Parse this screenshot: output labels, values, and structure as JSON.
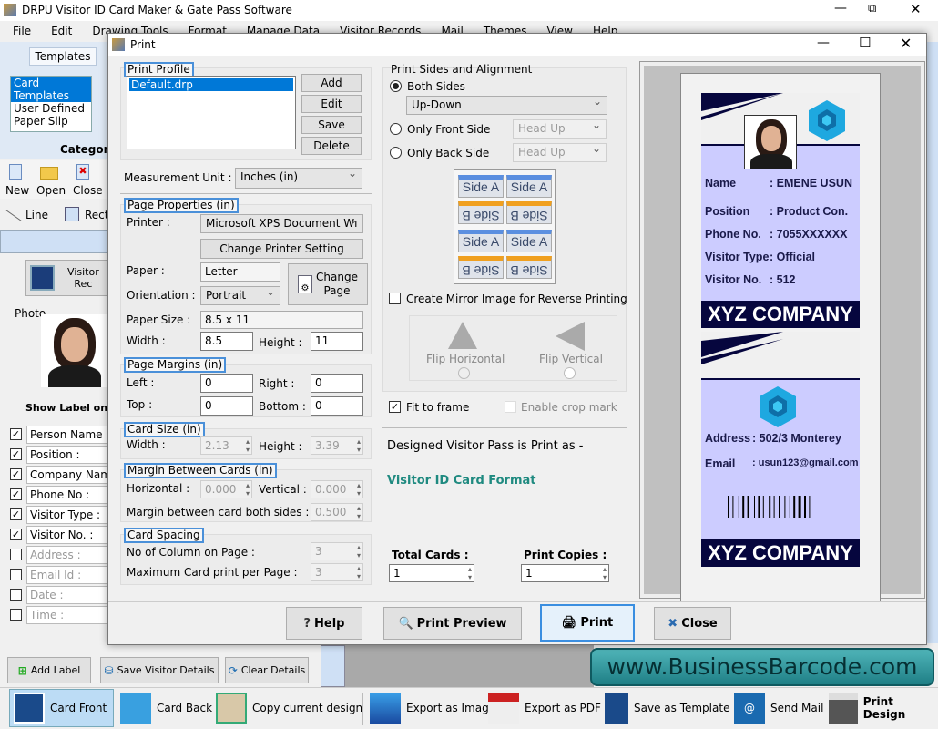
{
  "app": {
    "title": "DRPU Visitor ID Card Maker & Gate Pass Software",
    "menu": [
      "File",
      "Edit",
      "Drawing Tools",
      "Format",
      "Manage Data",
      "Visitor Records",
      "Mail",
      "Themes",
      "View",
      "Help"
    ],
    "templates_tab": "Templates",
    "category_items": [
      "Card Templates",
      "User Defined",
      "Paper Slip"
    ],
    "category_label": "Category",
    "file_buttons": [
      "New",
      "Open",
      "Close"
    ],
    "draw_tools": [
      "Line",
      "Recta"
    ],
    "visitor_records_button": "Visitor Rec",
    "photo_label": "Photo",
    "show_label_heading": "Show Label on Ca",
    "labels": [
      {
        "text": "Person Name :",
        "checked": true
      },
      {
        "text": "Position :",
        "checked": true
      },
      {
        "text": "Company Nam",
        "checked": true
      },
      {
        "text": "Phone No :",
        "checked": true
      },
      {
        "text": "Visitor Type :",
        "checked": true
      },
      {
        "text": "Visitor No. :",
        "checked": true
      },
      {
        "text": "Address :",
        "checked": false
      },
      {
        "text": "Email Id :",
        "checked": false
      },
      {
        "text": "Date :",
        "checked": false
      },
      {
        "text": "Time :",
        "checked": false
      }
    ],
    "bottom_buttons": [
      "Add Label",
      "Save Visitor Details",
      "Clear Details"
    ],
    "toolbar": [
      "Card Front",
      "Card Back",
      "Copy current design",
      "Export as Image",
      "Export as PDF",
      "Save as Template",
      "Send Mail",
      "Print Design"
    ],
    "banner": "www.BusinessBarcode.com"
  },
  "dialog": {
    "title": "Print",
    "print_profile": {
      "label": "Print Profile",
      "items": [
        "Default.drp"
      ],
      "buttons": [
        "Add",
        "Edit",
        "Save",
        "Delete"
      ]
    },
    "measurement_unit": {
      "label": "Measurement Unit :",
      "value": "Inches (in)"
    },
    "page_properties": {
      "label": "Page Properties (in)",
      "printer_label": "Printer :",
      "printer": "Microsoft XPS Document Wı",
      "change_printer": "Change Printer Setting",
      "paper_label": "Paper :",
      "paper": "Letter",
      "change_page": [
        "Change",
        "Page"
      ],
      "orientation_label": "Orientation :",
      "orientation": "Portrait",
      "paper_size_label": "Paper Size :",
      "paper_size": "8.5 x 11",
      "width_label": "Width :",
      "width": "8.5",
      "height_label": "Height :",
      "height": "11"
    },
    "page_margins": {
      "label": "Page Margins (in)",
      "left_label": "Left :",
      "left": "0",
      "right_label": "Right :",
      "right": "0",
      "top_label": "Top :",
      "top": "0",
      "bottom_label": "Bottom :",
      "bottom": "0"
    },
    "card_size": {
      "label": "Card Size (in)",
      "width_label": "Width :",
      "width": "2.13",
      "height_label": "Height :",
      "height": "3.39"
    },
    "margin_between": {
      "label": "Margin Between Cards (in)",
      "horizontal_label": "Horizontal :",
      "horizontal": "0.000",
      "vertical_label": "Vertical :",
      "vertical": "0.000",
      "both_sides_label": "Margin between card both sides :",
      "both_sides": "0.500"
    },
    "card_spacing": {
      "label": "Card Spacing",
      "columns_label": "No of Column on Page :",
      "columns": "3",
      "max_label": "Maximum Card print per Page :",
      "max": "3"
    },
    "sides": {
      "label": "Print Sides and Alignment",
      "both": "Both Sides",
      "both_value": "Up-Down",
      "front": "Only Front Side",
      "front_value": "Head Up",
      "back": "Only Back Side",
      "back_value": "Head Up",
      "selected": "both",
      "side_a": "Side A",
      "side_b": "Side B"
    },
    "mirror": {
      "label": "Create Mirror Image for Reverse Printing",
      "checked": false,
      "flip_h": "Flip Horizontal",
      "flip_v": "Flip Vertical"
    },
    "fit_to_frame": {
      "label": "Fit to frame",
      "checked": true
    },
    "crop_mark": {
      "label": "Enable crop mark",
      "checked": false
    },
    "print_as_text": "Designed Visitor Pass is Print as -",
    "print_as_value": "Visitor ID Card Format",
    "total_cards": {
      "label": "Total Cards :",
      "value": "1"
    },
    "print_copies": {
      "label": "Print Copies :",
      "value": "1"
    },
    "buttons": {
      "help": "Help",
      "preview": "Print Preview",
      "print": "Print",
      "close": "Close"
    }
  },
  "card": {
    "front_fields": [
      [
        "Name",
        ": EMENE USUN"
      ],
      [
        "Position",
        ": Product Con."
      ],
      [
        "Phone No.",
        ": 7055XXXXXX"
      ],
      [
        "Visitor Type",
        ": Official"
      ],
      [
        "Visitor No.",
        ": 512"
      ]
    ],
    "back_fields": [
      [
        "Address",
        ": 502/3 Monterey"
      ],
      [
        "Email",
        ": usun123@gmail.com"
      ]
    ],
    "company": "XYZ COMPANY",
    "colors": {
      "navy": "#06063e",
      "lavender": "#ccccff",
      "logo": "#1ea8e0"
    }
  }
}
